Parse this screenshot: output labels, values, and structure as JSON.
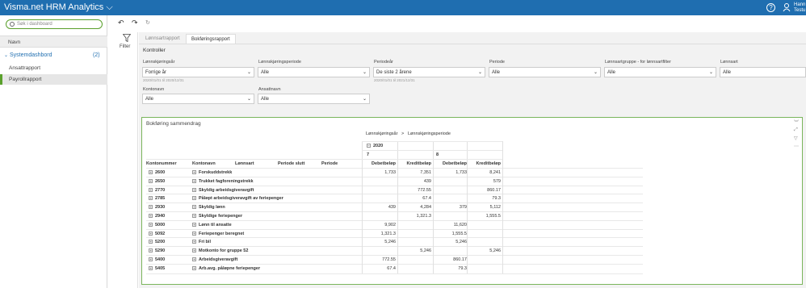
{
  "app": {
    "title": "Visma.net HRM Analytics",
    "user_line1": "Hann",
    "user_line2": "Testu"
  },
  "sidebar": {
    "search_placeholder": "Søk i dashboard",
    "header": "Navn",
    "group": {
      "label": "Systemdashbord",
      "count": "(2)"
    },
    "items": [
      {
        "label": "Ansattrapport"
      },
      {
        "label": "Payrollrapport"
      }
    ]
  },
  "filter_label": "Filter",
  "tabs": [
    {
      "label": "Lønnsartrapport"
    },
    {
      "label": "Bokføringsrapport"
    }
  ],
  "controls": {
    "title": "Kontroller",
    "fields": [
      {
        "label": "Lønnskjøringsår",
        "value": "Forrige år",
        "sub": "2020/01/01 til 2020/12/31"
      },
      {
        "label": "Lønnskjøringsperiode",
        "value": "Alle",
        "sub": ""
      },
      {
        "label": "Periodeår",
        "value": "De siste 2 årene",
        "sub": "2020/01/01 til 2021/12/31"
      },
      {
        "label": "Periode",
        "value": "Alle",
        "sub": ""
      },
      {
        "label": "Lønnsartgruppe - for lønnsartfilter",
        "value": "Alle",
        "sub": ""
      },
      {
        "label": "Lønnsart",
        "value": "Alle",
        "sub": ""
      },
      {
        "label": "Kontonavn",
        "value": "Alle",
        "sub": ""
      },
      {
        "label": "Ansattnavn",
        "value": "Alle",
        "sub": ""
      }
    ]
  },
  "panel": {
    "title": "Bokføring sammendrag",
    "crumb_1": "Lønnskjøringsår",
    "crumb_sep": ">",
    "crumb_2": "Lønnskjøringsperiode",
    "year": "2020",
    "periods": [
      "7",
      "8"
    ],
    "row_headers": [
      "Kontonummer",
      "Kontonavn",
      "Lønnsart",
      "Periode slutt",
      "Periode"
    ],
    "value_headers": [
      "Debetbeløp",
      "Kreditbeløp",
      "Debetbeløp",
      "Kreditbeløp"
    ],
    "rows": [
      {
        "konto": "2600",
        "navn": "Forskuddstrekk",
        "v": [
          "1,733",
          "7,351",
          "1,733",
          "8,241"
        ]
      },
      {
        "konto": "2650",
        "navn": "Trukket fagforeningstrekk",
        "v": [
          "",
          "439",
          "",
          "579"
        ]
      },
      {
        "konto": "2770",
        "navn": "Skyldig arbeidsgiveravgift",
        "v": [
          "",
          "772.55",
          "",
          "860.17"
        ]
      },
      {
        "konto": "2785",
        "navn": "Påløpt arbeidsgiveravgift av feriepenger",
        "v": [
          "",
          "67.4",
          "",
          "79.3"
        ]
      },
      {
        "konto": "2930",
        "navn": "Skyldig lønn",
        "v": [
          "439",
          "4,284",
          "379",
          "5,112"
        ]
      },
      {
        "konto": "2940",
        "navn": "Skyldige feriepenger",
        "v": [
          "",
          "1,321.3",
          "",
          "1,555.5"
        ]
      },
      {
        "konto": "5000",
        "navn": "Lønn til ansatte",
        "v": [
          "9,902",
          "",
          "11,620",
          ""
        ]
      },
      {
        "konto": "5092",
        "navn": "Feriepenger beregnet",
        "v": [
          "1,321.3",
          "",
          "1,555.5",
          ""
        ]
      },
      {
        "konto": "5200",
        "navn": "Fri bil",
        "v": [
          "5,246",
          "",
          "5,246",
          ""
        ]
      },
      {
        "konto": "5290",
        "navn": "Motkonto for gruppe 52",
        "v": [
          "",
          "5,246",
          "",
          "5,246"
        ]
      },
      {
        "konto": "5400",
        "navn": "Arbeidsgiveravgift",
        "v": [
          "772.55",
          "",
          "860.17",
          ""
        ]
      },
      {
        "konto": "5405",
        "navn": "Arb.avg. påløpne feriepenger",
        "v": [
          "67.4",
          "",
          "79.3",
          ""
        ]
      }
    ]
  },
  "colors": {
    "brand": "#1F6EB0",
    "accent": "#5aa02c"
  }
}
